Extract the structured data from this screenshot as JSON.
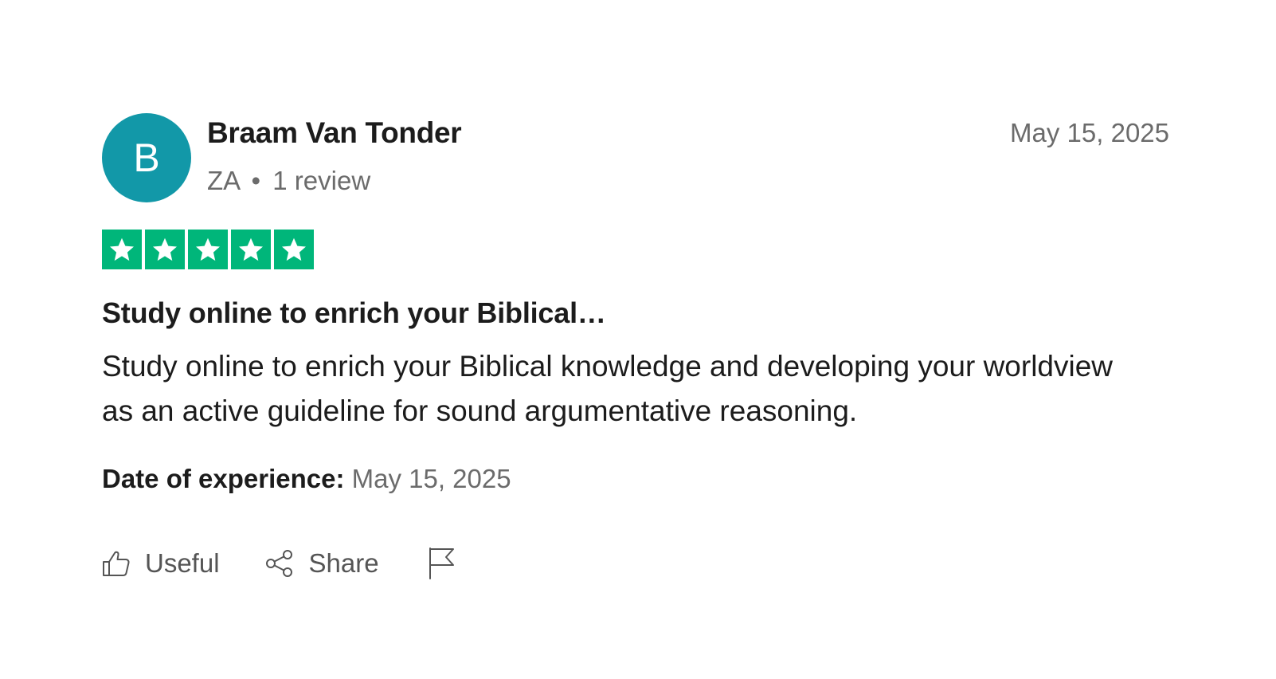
{
  "reviewer": {
    "initial": "B",
    "name": "Braam Van Tonder",
    "country": "ZA",
    "separator": "•",
    "review_count": "1 review",
    "avatar_color": "#1298a8"
  },
  "review": {
    "date": "May 15, 2025",
    "rating": 5,
    "rating_max": 5,
    "star_color": "#00b67a",
    "title": "Study online to enrich your Biblical…",
    "body": "Study online to enrich your Biblical knowledge and developing your worldview as an active guideline for sound argumentative reasoning.",
    "experience_label": "Date of experience:",
    "experience_date": "May 15, 2025"
  },
  "actions": {
    "useful_label": "Useful",
    "share_label": "Share",
    "useful_icon": "thumbs-up-icon",
    "share_icon": "share-icon",
    "report_icon": "flag-icon"
  }
}
